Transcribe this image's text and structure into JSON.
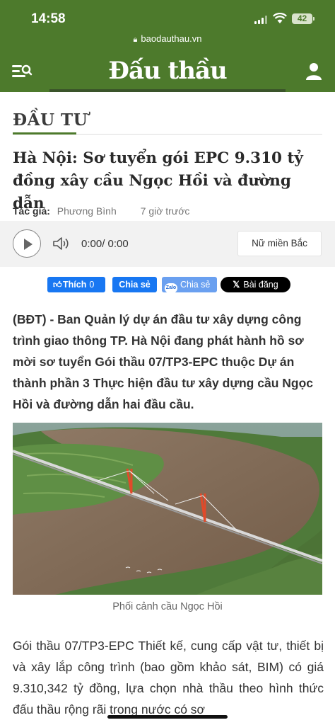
{
  "status_bar": {
    "time": "14:58",
    "battery": "42"
  },
  "browser": {
    "url": "baodauthau.vn"
  },
  "header": {
    "logo": "Đấu thầu"
  },
  "article": {
    "category": "ĐẦU TƯ",
    "title": "Hà Nội: Sơ tuyển gói EPC 9.310 tỷ đồng xây cầu Ngọc Hồi và đường dẫn",
    "author_label": "Tác giả:",
    "author": "Phương Bình",
    "time_ago": "7 giờ trước",
    "lead": "(BĐT) - Ban Quản lý dự án đầu tư xây dựng công trình giao thông TP. Hà Nội đang phát hành hồ sơ mời sơ tuyển Gói thầu 07/TP3-EPC thuộc Dự án thành phần 3 Thực hiện đầu tư xây dựng cầu Ngọc Hồi và đường dẫn hai đầu cầu.",
    "image_caption": "Phối cảnh cầu Ngọc Hồi",
    "body": "Gói thầu 07/TP3-EPC Thiết kế, cung cấp vật tư, thiết bị và xây lắp công trình (bao gồm khảo sát, BIM) có giá 9.310,342 tỷ đồng, lựa chọn nhà thầu theo hình thức đấu thầu rộng rãi trong nước có sơ"
  },
  "player": {
    "timecode": "0:00/ 0:00",
    "voice": "Nữ miền Bắc"
  },
  "share": {
    "fb_like": "Thích",
    "fb_like_count": "0",
    "fb_share": "Chia sẻ",
    "zalo_share": "Chia sẻ",
    "x_post": "Bài đăng"
  },
  "colors": {
    "brand_green": "#4d7a2c",
    "facebook_blue": "#1877f2",
    "zalo_blue": "#6aa0f0"
  }
}
